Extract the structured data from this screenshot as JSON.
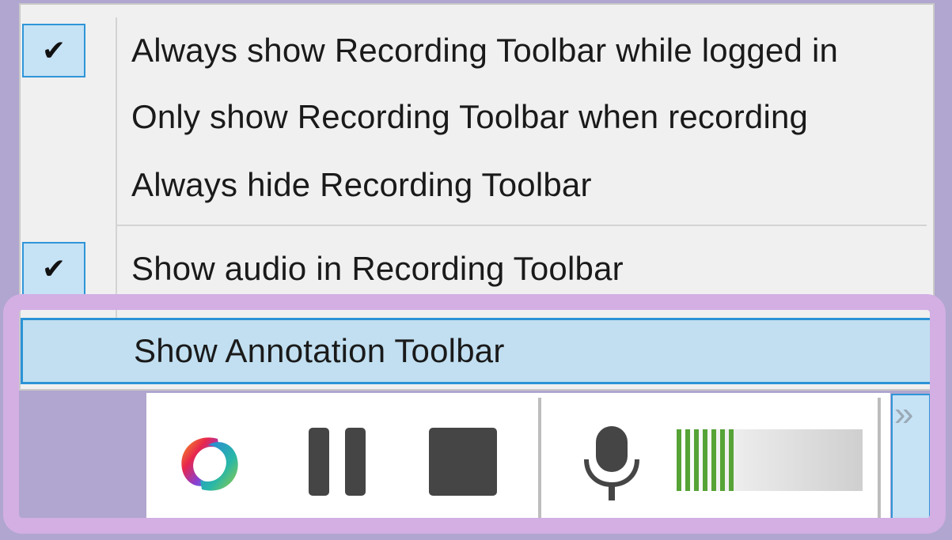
{
  "menu": {
    "items": [
      {
        "label": "Always show Recording Toolbar while logged in",
        "checked": true
      },
      {
        "label": "Only show Recording Toolbar when recording",
        "checked": false
      },
      {
        "label": "Always hide Recording Toolbar",
        "checked": false
      },
      {
        "label": "Show audio in Recording Toolbar",
        "checked": true
      },
      {
        "label": "Show Annotation Toolbar",
        "checked": false,
        "highlighted": true
      }
    ],
    "check_glyph": "✔"
  },
  "toolbar": {
    "icons": [
      "app-logo-icon",
      "pause-icon",
      "stop-icon",
      "microphone-icon",
      "overflow-chevron-icon"
    ],
    "audio_level_fraction": 0.33,
    "audio_level_color": "#56a336",
    "overflow_glyph": "»"
  },
  "colors": {
    "background": "#b0a6cf",
    "highlight_frame": "#d3afe4",
    "selection": "#c1dff0",
    "selection_border": "#2b93d6"
  }
}
